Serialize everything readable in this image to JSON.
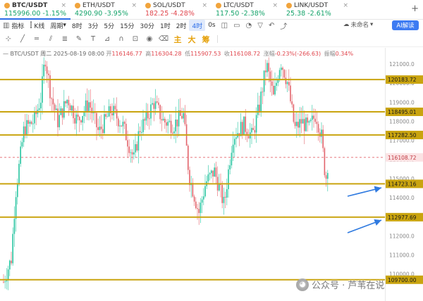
{
  "tickers": [
    {
      "symbol": "BTC/USDT",
      "price": "115996.00",
      "change": "-1.15%",
      "trend": "up",
      "active": true
    },
    {
      "symbol": "ETH/USDT",
      "price": "4290.90",
      "change": "-3.95%",
      "trend": "up",
      "active": false
    },
    {
      "symbol": "SOL/USDT",
      "price": "182.25",
      "change": "-4.28%",
      "trend": "down",
      "active": false
    },
    {
      "symbol": "LTC/USDT",
      "price": "117.50",
      "change": "-2.38%",
      "trend": "up",
      "active": false
    },
    {
      "symbol": "LINK/USDT",
      "price": "25.38",
      "change": "-2.61%",
      "trend": "up",
      "active": false
    }
  ],
  "toolbar": {
    "indicator_label": "指标",
    "line_label": "K线",
    "period_label": "周期",
    "timeframes": [
      "8时",
      "3分",
      "5分",
      "15分",
      "30分",
      "1时",
      "2时",
      "4时"
    ],
    "active_timeframe": "4时",
    "zero_s": "0s",
    "save_label": "未命名",
    "ai_label": "AI解读"
  },
  "drawbar": {
    "indicators": [
      "主",
      "大",
      "筹"
    ]
  },
  "legend": {
    "symbol": "BTC/USDT",
    "day": "周二",
    "datetime": "2025-08-19 08:00",
    "open_label": "开",
    "open": "116146.77",
    "high_label": "高",
    "high": "116304.28",
    "low_label": "低",
    "low": "115907.53",
    "close_label": "收",
    "close": "116108.72",
    "change_label": "涨幅",
    "change": "-0.23%(-266.63)",
    "amp_label": "振幅",
    "amp": "0.34%"
  },
  "chart_data": {
    "type": "candlestick",
    "y_ticks": [
      110000,
      111000,
      112000,
      113000,
      114000,
      115000,
      116000,
      117000,
      118000,
      119000,
      120000,
      121000
    ],
    "y_range": [
      109500,
      122200
    ],
    "levels": [
      "120183.72",
      "118495.01",
      "117282.50",
      "114723.16",
      "112977.69",
      "109700.00"
    ],
    "current_price": "116108.72",
    "up_color": "#26c4a0",
    "down_color": "#e2636b",
    "level_color": "#c9a40f",
    "current_color": "#e2636b",
    "arrow_color": "#2f7ae0"
  },
  "watermark": {
    "text": "公众号 · 芦苇在说"
  }
}
